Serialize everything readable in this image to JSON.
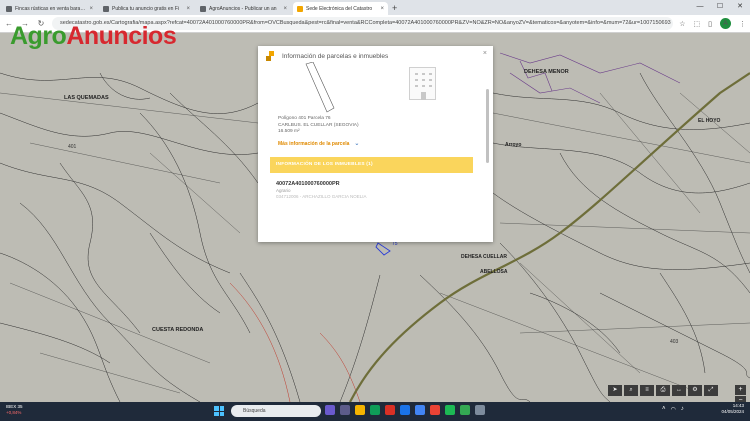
{
  "browser": {
    "tabs": [
      {
        "title": "Fincas rústicas en venta baratas",
        "active": false
      },
      {
        "title": "Publica tu anuncio gratis en Fi",
        "active": false
      },
      {
        "title": "AgroAnuncios - Publicar un an",
        "active": false
      },
      {
        "title": "Sede Electrónica del Catastro",
        "active": true
      }
    ],
    "new_tab_symbol": "+",
    "url": "sedecatastro.gob.es/Cartografia/mapa.aspx?refcat=40072A401000760000PR&from=OVCBusqueda&pest=rc&final=venta&RCCompleta=40072A401000760000PR&ZV=NO&ZR=NO&anyoZV=&tematicos=&anyotem=&info=&mum=72&ur=1007150693",
    "profile_initial": "A"
  },
  "logo": {
    "part1": "Agro",
    "part2": "Anuncios"
  },
  "map_labels": {
    "las_quemadas": "LAS QUEMADAS",
    "dehesa_menor": "DEHESA MENOR",
    "el_hoyo": "EL HOYO",
    "arroyo": "Arroyo",
    "dehesa_cuellar": "DEHESA CUELLAR",
    "abellosa": "ABELLOSA",
    "cuesta_redonda": "CUESTA REDONDA",
    "num_401": "401",
    "num_403": "403",
    "num_75": "75"
  },
  "popup": {
    "title": "Información de parcelas e inmuebles",
    "close": "×",
    "parcel_line1": "Polígono 401 Parcela 76",
    "parcel_line2": "CARLBUS. EL CUELLAR (SEGOVIA)",
    "parcel_line3": "16.509 m²",
    "more_info": "Más información de la parcela",
    "section_title": "INFORMACIÓN DE LOS INMUEBLES (1)",
    "ref_code": "40072A401000760000PR",
    "ref_use": "Agrario",
    "ref_owner": "034712006 - ARCHAZILLO GARCIA NOELIA"
  },
  "taskbar": {
    "index_name": "IBEX 35",
    "index_change": "+0,84%",
    "search_placeholder": "Búsqueda",
    "time": "14:43",
    "date": "04/05/2024"
  },
  "colors": {
    "map_bg": "#bdbcb4",
    "band": "#fad55c",
    "link_orange": "#e08a00",
    "logo_green": "#3a9b2e",
    "logo_red": "#d7282f"
  }
}
